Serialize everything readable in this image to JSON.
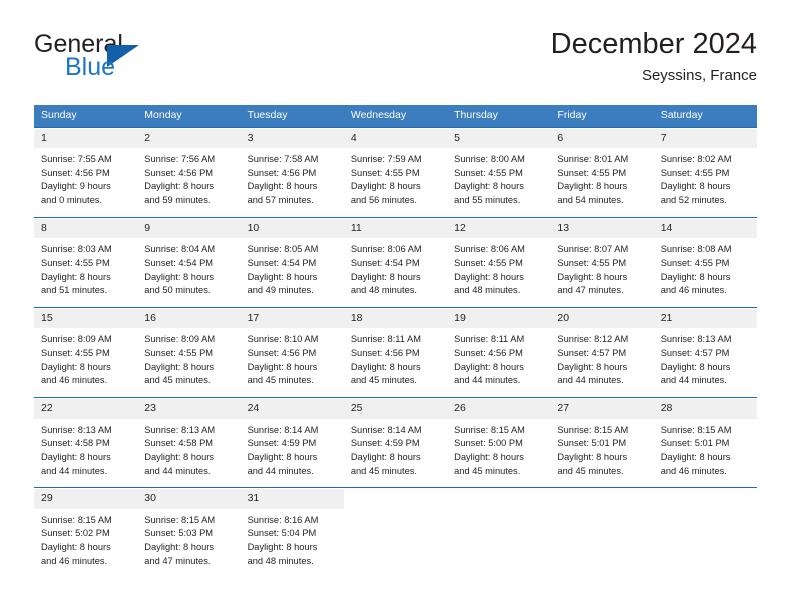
{
  "brand": {
    "name_part1": "General",
    "name_part2": "Blue",
    "triangle_color": "#1260a8",
    "blue_color": "#1b77c4"
  },
  "header": {
    "title": "December 2024",
    "subtitle": "Seyssins, France"
  },
  "theme": {
    "header_row_bg": "#3b7dbe",
    "week_separator": "#1f6cb0",
    "daynum_bg": "#f0f0f0",
    "text": "#231f20"
  },
  "weekdays": [
    "Sunday",
    "Monday",
    "Tuesday",
    "Wednesday",
    "Thursday",
    "Friday",
    "Saturday"
  ],
  "weeks": [
    {
      "days": [
        {
          "num": "1",
          "sunrise": "Sunrise: 7:55 AM",
          "sunset": "Sunset: 4:56 PM",
          "daylight1": "Daylight: 9 hours",
          "daylight2": "and 0 minutes."
        },
        {
          "num": "2",
          "sunrise": "Sunrise: 7:56 AM",
          "sunset": "Sunset: 4:56 PM",
          "daylight1": "Daylight: 8 hours",
          "daylight2": "and 59 minutes."
        },
        {
          "num": "3",
          "sunrise": "Sunrise: 7:58 AM",
          "sunset": "Sunset: 4:56 PM",
          "daylight1": "Daylight: 8 hours",
          "daylight2": "and 57 minutes."
        },
        {
          "num": "4",
          "sunrise": "Sunrise: 7:59 AM",
          "sunset": "Sunset: 4:55 PM",
          "daylight1": "Daylight: 8 hours",
          "daylight2": "and 56 minutes."
        },
        {
          "num": "5",
          "sunrise": "Sunrise: 8:00 AM",
          "sunset": "Sunset: 4:55 PM",
          "daylight1": "Daylight: 8 hours",
          "daylight2": "and 55 minutes."
        },
        {
          "num": "6",
          "sunrise": "Sunrise: 8:01 AM",
          "sunset": "Sunset: 4:55 PM",
          "daylight1": "Daylight: 8 hours",
          "daylight2": "and 54 minutes."
        },
        {
          "num": "7",
          "sunrise": "Sunrise: 8:02 AM",
          "sunset": "Sunset: 4:55 PM",
          "daylight1": "Daylight: 8 hours",
          "daylight2": "and 52 minutes."
        }
      ]
    },
    {
      "days": [
        {
          "num": "8",
          "sunrise": "Sunrise: 8:03 AM",
          "sunset": "Sunset: 4:55 PM",
          "daylight1": "Daylight: 8 hours",
          "daylight2": "and 51 minutes."
        },
        {
          "num": "9",
          "sunrise": "Sunrise: 8:04 AM",
          "sunset": "Sunset: 4:54 PM",
          "daylight1": "Daylight: 8 hours",
          "daylight2": "and 50 minutes."
        },
        {
          "num": "10",
          "sunrise": "Sunrise: 8:05 AM",
          "sunset": "Sunset: 4:54 PM",
          "daylight1": "Daylight: 8 hours",
          "daylight2": "and 49 minutes."
        },
        {
          "num": "11",
          "sunrise": "Sunrise: 8:06 AM",
          "sunset": "Sunset: 4:54 PM",
          "daylight1": "Daylight: 8 hours",
          "daylight2": "and 48 minutes."
        },
        {
          "num": "12",
          "sunrise": "Sunrise: 8:06 AM",
          "sunset": "Sunset: 4:55 PM",
          "daylight1": "Daylight: 8 hours",
          "daylight2": "and 48 minutes."
        },
        {
          "num": "13",
          "sunrise": "Sunrise: 8:07 AM",
          "sunset": "Sunset: 4:55 PM",
          "daylight1": "Daylight: 8 hours",
          "daylight2": "and 47 minutes."
        },
        {
          "num": "14",
          "sunrise": "Sunrise: 8:08 AM",
          "sunset": "Sunset: 4:55 PM",
          "daylight1": "Daylight: 8 hours",
          "daylight2": "and 46 minutes."
        }
      ]
    },
    {
      "days": [
        {
          "num": "15",
          "sunrise": "Sunrise: 8:09 AM",
          "sunset": "Sunset: 4:55 PM",
          "daylight1": "Daylight: 8 hours",
          "daylight2": "and 46 minutes."
        },
        {
          "num": "16",
          "sunrise": "Sunrise: 8:09 AM",
          "sunset": "Sunset: 4:55 PM",
          "daylight1": "Daylight: 8 hours",
          "daylight2": "and 45 minutes."
        },
        {
          "num": "17",
          "sunrise": "Sunrise: 8:10 AM",
          "sunset": "Sunset: 4:56 PM",
          "daylight1": "Daylight: 8 hours",
          "daylight2": "and 45 minutes."
        },
        {
          "num": "18",
          "sunrise": "Sunrise: 8:11 AM",
          "sunset": "Sunset: 4:56 PM",
          "daylight1": "Daylight: 8 hours",
          "daylight2": "and 45 minutes."
        },
        {
          "num": "19",
          "sunrise": "Sunrise: 8:11 AM",
          "sunset": "Sunset: 4:56 PM",
          "daylight1": "Daylight: 8 hours",
          "daylight2": "and 44 minutes."
        },
        {
          "num": "20",
          "sunrise": "Sunrise: 8:12 AM",
          "sunset": "Sunset: 4:57 PM",
          "daylight1": "Daylight: 8 hours",
          "daylight2": "and 44 minutes."
        },
        {
          "num": "21",
          "sunrise": "Sunrise: 8:13 AM",
          "sunset": "Sunset: 4:57 PM",
          "daylight1": "Daylight: 8 hours",
          "daylight2": "and 44 minutes."
        }
      ]
    },
    {
      "days": [
        {
          "num": "22",
          "sunrise": "Sunrise: 8:13 AM",
          "sunset": "Sunset: 4:58 PM",
          "daylight1": "Daylight: 8 hours",
          "daylight2": "and 44 minutes."
        },
        {
          "num": "23",
          "sunrise": "Sunrise: 8:13 AM",
          "sunset": "Sunset: 4:58 PM",
          "daylight1": "Daylight: 8 hours",
          "daylight2": "and 44 minutes."
        },
        {
          "num": "24",
          "sunrise": "Sunrise: 8:14 AM",
          "sunset": "Sunset: 4:59 PM",
          "daylight1": "Daylight: 8 hours",
          "daylight2": "and 44 minutes."
        },
        {
          "num": "25",
          "sunrise": "Sunrise: 8:14 AM",
          "sunset": "Sunset: 4:59 PM",
          "daylight1": "Daylight: 8 hours",
          "daylight2": "and 45 minutes."
        },
        {
          "num": "26",
          "sunrise": "Sunrise: 8:15 AM",
          "sunset": "Sunset: 5:00 PM",
          "daylight1": "Daylight: 8 hours",
          "daylight2": "and 45 minutes."
        },
        {
          "num": "27",
          "sunrise": "Sunrise: 8:15 AM",
          "sunset": "Sunset: 5:01 PM",
          "daylight1": "Daylight: 8 hours",
          "daylight2": "and 45 minutes."
        },
        {
          "num": "28",
          "sunrise": "Sunrise: 8:15 AM",
          "sunset": "Sunset: 5:01 PM",
          "daylight1": "Daylight: 8 hours",
          "daylight2": "and 46 minutes."
        }
      ]
    },
    {
      "days": [
        {
          "num": "29",
          "sunrise": "Sunrise: 8:15 AM",
          "sunset": "Sunset: 5:02 PM",
          "daylight1": "Daylight: 8 hours",
          "daylight2": "and 46 minutes."
        },
        {
          "num": "30",
          "sunrise": "Sunrise: 8:15 AM",
          "sunset": "Sunset: 5:03 PM",
          "daylight1": "Daylight: 8 hours",
          "daylight2": "and 47 minutes."
        },
        {
          "num": "31",
          "sunrise": "Sunrise: 8:16 AM",
          "sunset": "Sunset: 5:04 PM",
          "daylight1": "Daylight: 8 hours",
          "daylight2": "and 48 minutes."
        },
        {
          "num": "",
          "sunrise": "",
          "sunset": "",
          "daylight1": "",
          "daylight2": ""
        },
        {
          "num": "",
          "sunrise": "",
          "sunset": "",
          "daylight1": "",
          "daylight2": ""
        },
        {
          "num": "",
          "sunrise": "",
          "sunset": "",
          "daylight1": "",
          "daylight2": ""
        },
        {
          "num": "",
          "sunrise": "",
          "sunset": "",
          "daylight1": "",
          "daylight2": ""
        }
      ]
    }
  ]
}
